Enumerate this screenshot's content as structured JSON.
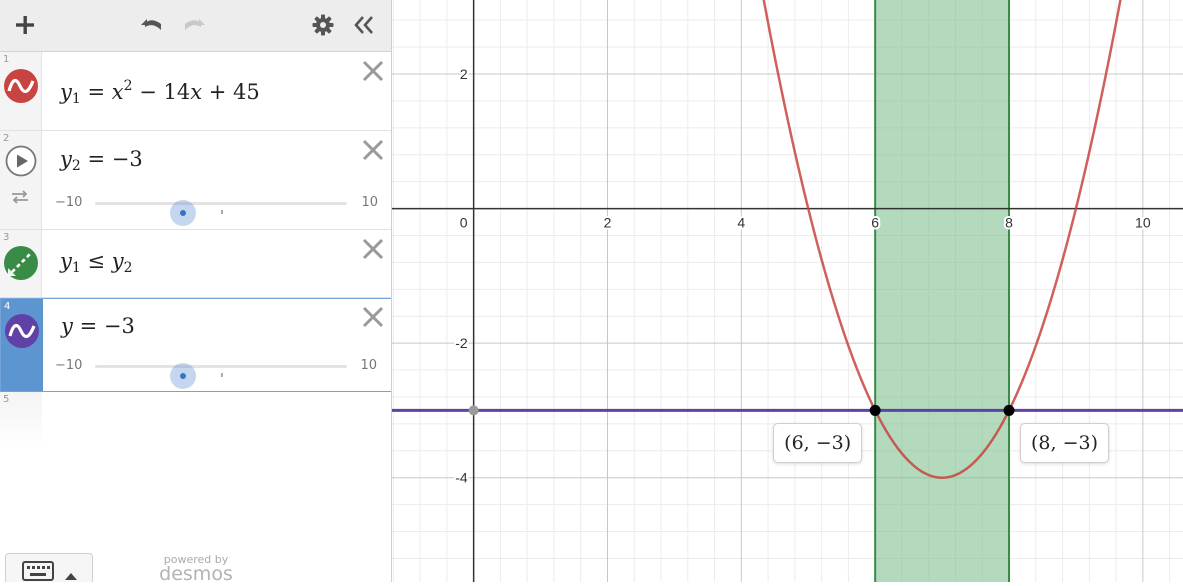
{
  "colors": {
    "accent": "#5d95d0",
    "red": "#c74440",
    "green": "#388c46",
    "purple": "#6042a6",
    "fill_green": "#82c291"
  },
  "toolbar": {
    "add_icon": "plus-icon",
    "undo_icon": "undo-icon",
    "redo_icon": "redo-icon",
    "settings_icon": "gear-icon",
    "collapse_icon": "double-chevron-left-icon"
  },
  "expressions": [
    {
      "index": "1",
      "y": "y",
      "sub": "1",
      "eq": "=",
      "rhs_x": "x",
      "rhs_pow": "2",
      "rhs_rest": "− 14",
      "rhs_x2": "x",
      "rhs_tail": "+ 45",
      "color": "#c74440",
      "icon": "function-wave-icon"
    },
    {
      "index": "2",
      "y": "y",
      "sub": "2",
      "eq": "=",
      "rhs": "−3",
      "slider_min": "−10",
      "slider_max": "10",
      "slider_value": -3,
      "icon": "play-icon",
      "loop_icon": "loop-icon"
    },
    {
      "index": "3",
      "lhs": "y",
      "lhs_sub": "1",
      "op": "≤",
      "rhs": "y",
      "rhs_sub": "2",
      "color": "#388c46",
      "icon": "inequality-shade-icon"
    },
    {
      "index": "4",
      "y": "y",
      "eq": "=",
      "rhs": "−3",
      "slider_min": "−10",
      "slider_max": "10",
      "slider_value": -3,
      "color": "#6042a6",
      "icon": "function-wave-icon"
    },
    {
      "index": "5"
    }
  ],
  "keyboard_icon": "keyboard-icon",
  "powered_by": {
    "small": "powered by",
    "logo": "desmos"
  },
  "graph": {
    "x_ticks": [
      "0",
      "2",
      "4",
      "6",
      "8",
      "10"
    ],
    "y_ticks": [
      "2",
      "-2",
      "-4"
    ],
    "x_tick_values": [
      0,
      2,
      4,
      6,
      8,
      10
    ],
    "y_tick_values": [
      2,
      -2,
      -4
    ],
    "x_range": [
      -1.22,
      10.6
    ],
    "y_range": [
      -5.55,
      3.1
    ],
    "points": [
      {
        "x": 6,
        "y": -3,
        "label": "(6, −3)"
      },
      {
        "x": 8,
        "y": -3,
        "label": "(8, −3)"
      }
    ]
  }
}
